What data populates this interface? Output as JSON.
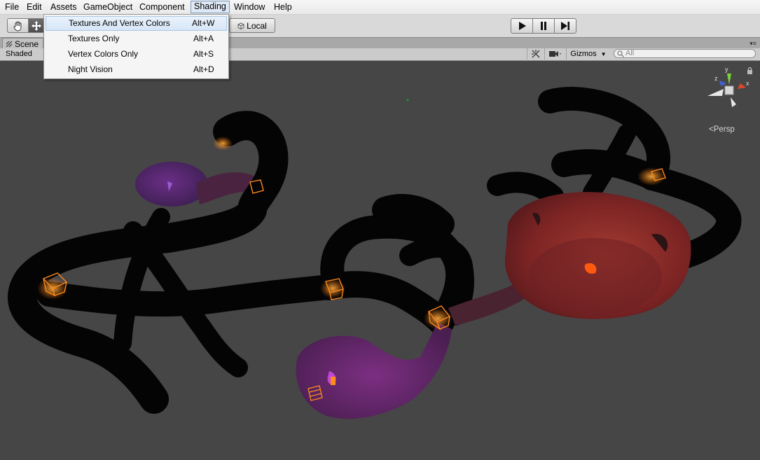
{
  "menubar": {
    "items": [
      "File",
      "Edit",
      "Assets",
      "GameObject",
      "Component",
      "Shading",
      "Window",
      "Help"
    ]
  },
  "toolbar": {
    "tools": [
      {
        "icon": "hand-icon",
        "active": false
      },
      {
        "icon": "move-icon",
        "active": true
      }
    ],
    "local_label": "Local",
    "play": [
      "play-icon",
      "pause-icon",
      "step-icon"
    ]
  },
  "scene_tab": {
    "label": "Scene"
  },
  "scene_bar": {
    "render_mode": "Shaded",
    "gizmos_label": "Gizmos",
    "search_placeholder": "All"
  },
  "shading_menu": {
    "items": [
      {
        "label": "Textures And Vertex Colors",
        "shortcut": "Alt+W",
        "highlighted": true
      },
      {
        "label": "Textures Only",
        "shortcut": "Alt+A",
        "highlighted": false
      },
      {
        "label": "Vertex Colors Only",
        "shortcut": "Alt+S",
        "highlighted": false
      },
      {
        "label": "Night Vision",
        "shortcut": "Alt+D",
        "highlighted": false
      }
    ]
  },
  "viewport": {
    "projection_label": "Persp",
    "gizmo_axes": {
      "x": "x",
      "y": "y",
      "z": "z"
    }
  },
  "colors": {
    "viewport_bg": "#464646",
    "path_dark": "#040404",
    "island_purple": "#5b2a74",
    "island_red": "#8e2b2b",
    "light_orange": "#ff8a1c"
  }
}
